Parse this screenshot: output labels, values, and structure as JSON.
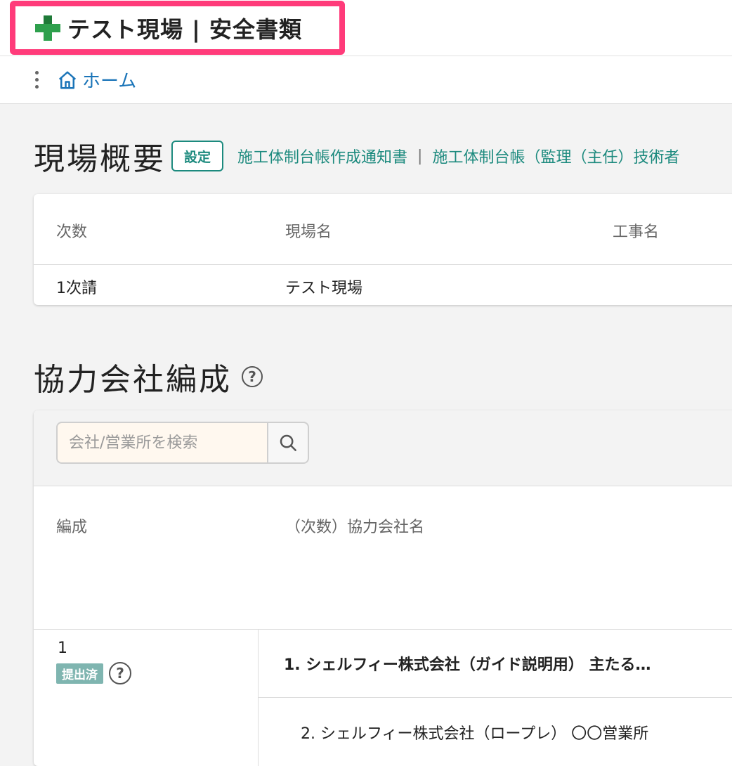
{
  "header": {
    "title": "テスト現場 | 安全書類",
    "brand_icon": "green-plus-icon",
    "brand_color": "#2ea04d",
    "highlight_color": "#ff3b7a"
  },
  "nav": {
    "menu_icon": "kebab-menu-icon",
    "home_label": "ホーム"
  },
  "overview": {
    "heading": "現場概要",
    "settings_label": "設定",
    "links": [
      "施工体制台帳作成通知書",
      "施工体制台帳（監理（主任）技術者"
    ],
    "link_separator": "|",
    "columns": [
      "次数",
      "現場名",
      "工事名"
    ],
    "rows": [
      [
        "1次請",
        "テスト現場",
        ""
      ]
    ]
  },
  "partners": {
    "heading": "協力会社編成",
    "help_glyph": "?",
    "search": {
      "placeholder": "会社/営業所を検索",
      "value": ""
    },
    "columns": [
      "編成",
      "（次数）協力会社名"
    ],
    "groups": [
      {
        "number": "1",
        "status": "提出済",
        "status_color": "#7fb5b0",
        "companies": [
          "1. シェルフィー株式会社（ガイド説明用） 主たる…",
          "2. シェルフィー株式会社（ロープレ） 〇〇営業所"
        ]
      }
    ]
  },
  "accent_color": "#1c8a7e",
  "link_color": "#1a74b8"
}
